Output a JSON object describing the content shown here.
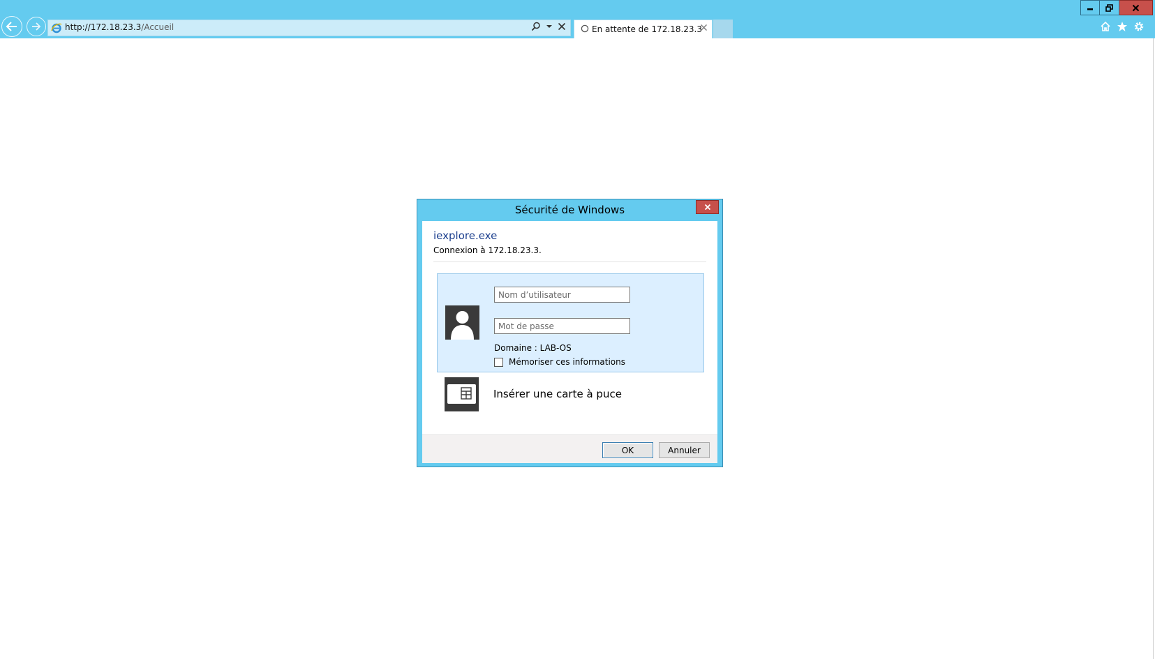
{
  "browser": {
    "address_url_host": "http://172.18.23.3",
    "address_url_path": "/Accueil",
    "tab_title": "En attente de 172.18.23.3",
    "accent_color": "#64cbef",
    "close_color": "#c7504b"
  },
  "dialog": {
    "title": "Sécurité de Windows",
    "app_name": "iexplore.exe",
    "subtitle": "Connexion à 172.18.23.3.",
    "username_placeholder": "Nom d’utilisateur",
    "password_placeholder": "Mot de passe",
    "domain_label": "Domaine : LAB-OS",
    "remember_label": "Mémoriser ces informations",
    "remember_checked": false,
    "smartcard_label": "Insérer une carte à puce",
    "ok_label": "OK",
    "cancel_label": "Annuler"
  },
  "icons": {
    "back": "back-arrow-icon",
    "forward": "forward-arrow-icon",
    "ie": "ie-logo-icon",
    "search": "search-icon",
    "stop": "close-icon",
    "home": "home-icon",
    "favorites": "star-icon",
    "settings": "gear-icon",
    "user": "user-avatar-icon",
    "smartcard": "smartcard-icon"
  }
}
